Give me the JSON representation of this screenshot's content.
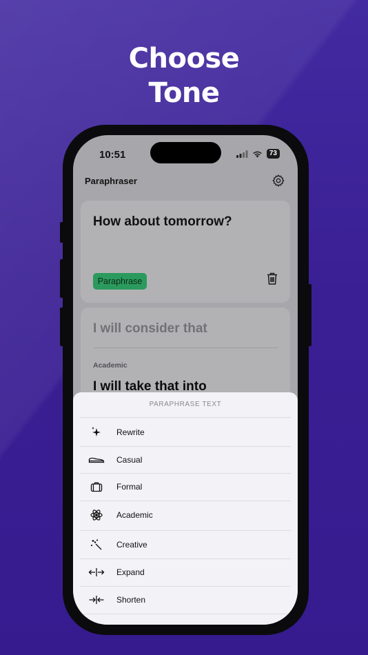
{
  "headline": {
    "line1": "Choose",
    "line2": "Tone"
  },
  "status_bar": {
    "time": "10:51",
    "battery": "73"
  },
  "app": {
    "title": "Paraphraser"
  },
  "input_card": {
    "text": "How about tomorrow?",
    "button_label": "Paraphrase"
  },
  "result_card": {
    "original_text": "I will consider that",
    "tone_label": "Academic",
    "result_text": "I will take that into"
  },
  "sheet": {
    "title": "PARAPHRASE TEXT",
    "items": [
      {
        "label": "Rewrite",
        "icon": "sparkle-icon"
      },
      {
        "label": "Casual",
        "icon": "sneaker-icon"
      },
      {
        "label": "Formal",
        "icon": "briefcase-icon"
      },
      {
        "label": "Academic",
        "icon": "atom-icon"
      },
      {
        "label": "Creative",
        "icon": "magic-wand-icon"
      },
      {
        "label": "Expand",
        "icon": "expand-arrows-icon"
      },
      {
        "label": "Shorten",
        "icon": "shorten-arrows-icon"
      }
    ]
  },
  "colors": {
    "background": "#3a1f94",
    "accent_green": "#2b9a5d",
    "sheet_bg": "#f2f2f7"
  }
}
